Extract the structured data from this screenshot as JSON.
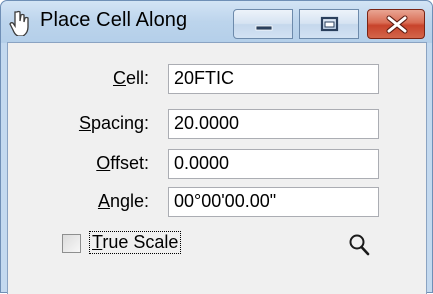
{
  "window": {
    "title": "Place Cell Along",
    "icons": {
      "app": "hand-cursor-icon",
      "minimize": "minimize-icon",
      "maximize": "maximize-icon",
      "close": "close-icon"
    },
    "colors": {
      "close_button": "#c8432b",
      "titlebar": "#bcd4ec"
    }
  },
  "form": {
    "fields": [
      {
        "label_accel": "C",
        "label_rest": "ell:",
        "value": "20FTIC"
      },
      {
        "label_accel": "S",
        "label_rest": "pacing:",
        "value": "20.0000"
      },
      {
        "label_accel": "O",
        "label_rest": "ffset:",
        "value": "0.0000"
      },
      {
        "label_accel": "A",
        "label_rest": "ngle:",
        "value": "00°00'00.00\""
      }
    ],
    "true_scale": {
      "label_accel": "T",
      "label_rest": "rue Scale",
      "checked": false
    },
    "zoom_icon": "magnifier-icon"
  }
}
